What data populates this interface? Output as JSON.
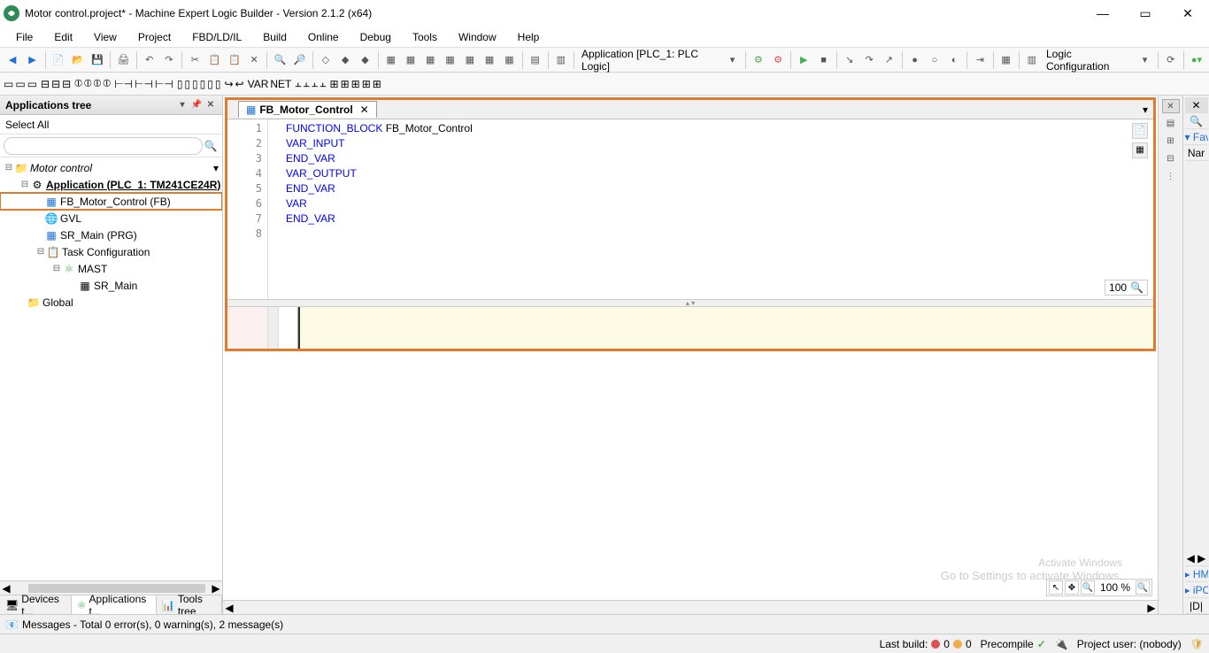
{
  "titlebar": {
    "title": "Motor control.project* - Machine Expert Logic Builder - Version 2.1.2 (x64)"
  },
  "menubar": {
    "items": [
      "File",
      "Edit",
      "View",
      "Project",
      "FBD/LD/IL",
      "Build",
      "Online",
      "Debug",
      "Tools",
      "Window",
      "Help"
    ]
  },
  "toolbar": {
    "app_context": "Application [PLC_1: PLC Logic]",
    "logic_config": "Logic Configuration"
  },
  "sidebar": {
    "panel_title": "Applications tree",
    "select_label": "Select All",
    "search_placeholder": "",
    "tree": {
      "root": "Motor control",
      "app": "Application (PLC_1: TM241CE24R)",
      "fb": "FB_Motor_Control (FB)",
      "gvl": "GVL",
      "sr_main_prg": "SR_Main (PRG)",
      "task_conf": "Task Configuration",
      "mast": "MAST",
      "sr_main_task": "SR_Main",
      "global": "Global"
    },
    "tabs": {
      "devices": "Devices t...",
      "apps": "Applications t...",
      "tools": "Tools tree"
    }
  },
  "editor": {
    "tab_title": "FB_Motor_Control",
    "lines": {
      "l1a": "FUNCTION_BLOCK",
      "l1b": " FB_Motor_Control",
      "l2": "VAR_INPUT",
      "l3": "END_VAR",
      "l4": "VAR_OUTPUT",
      "l5": "END_VAR",
      "l6": "VAR",
      "l7": "END_VAR"
    },
    "zoom_decl": "100",
    "zoom_body": "100 %"
  },
  "right_panel": {
    "fav": "▾ Fav",
    "nar": "Nar",
    "hm": "▸ HM",
    "ipc": "▸ iPC",
    "d": "|D|"
  },
  "status": {
    "messages_summary": "Messages - Total 0 error(s), 0 warning(s), 2 message(s)",
    "last_build_label": "Last build:",
    "errors": "0",
    "warnings": "0",
    "precompile": "Precompile",
    "project_user": "Project user: (nobody)"
  },
  "watermark": {
    "line1": "Activate Windows",
    "line2": "Go to Settings to activate Windows."
  }
}
